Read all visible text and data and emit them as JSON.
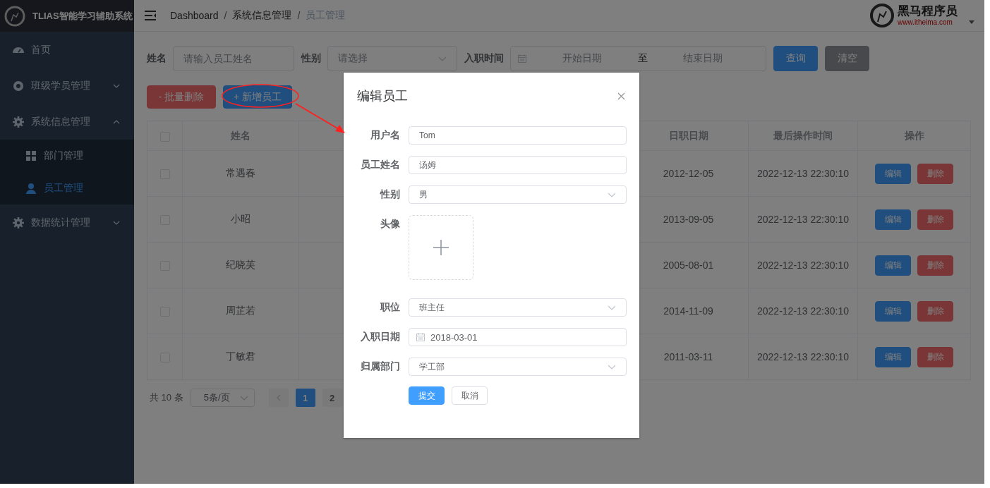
{
  "app": {
    "title": "TLIAS智能学习辅助系统"
  },
  "sidebar": {
    "items": [
      {
        "label": "首页",
        "kind": "link",
        "selected": false
      },
      {
        "label": "班级学员管理",
        "kind": "group",
        "expanded": false,
        "selected": false
      },
      {
        "label": "系统信息管理",
        "kind": "group",
        "expanded": true,
        "selected": false,
        "children": [
          {
            "label": "部门管理",
            "selected": false
          },
          {
            "label": "员工管理",
            "selected": true
          }
        ]
      },
      {
        "label": "数据统计管理",
        "kind": "group",
        "expanded": false,
        "selected": false
      }
    ]
  },
  "header": {
    "breadcrumb": [
      "Dashboard",
      "系统信息管理",
      "员工管理"
    ],
    "breadcrumb_separator": "/",
    "brand": {
      "name": "黑马程序员",
      "url": "www.itheima.com"
    }
  },
  "search": {
    "name_label": "姓名",
    "name_placeholder": "请输入员工姓名",
    "gender_label": "性别",
    "gender_placeholder": "请选择",
    "date_label": "入职时间",
    "start_placeholder": "开始日期",
    "range_separator": "至",
    "end_placeholder": "结束日期",
    "query_button": "查询",
    "clear_button": "清空"
  },
  "actions": [
    {
      "label": "- 批量删除",
      "kind": "danger"
    },
    {
      "label": "+ 新增员工",
      "kind": "primary"
    }
  ],
  "table": {
    "columns": [
      "姓名",
      "日职日期",
      "最后操作时间",
      "操作"
    ],
    "header_checked": false,
    "rows": [
      {
        "checked": false,
        "name": "常遇春",
        "entry_date": "2012-12-05",
        "update_time": "2022-12-13 22:30:10",
        "actions": [
          "编辑",
          "删除"
        ]
      },
      {
        "checked": false,
        "name": "小昭",
        "entry_date": "2013-09-05",
        "update_time": "2022-12-13 22:30:10",
        "actions": [
          "编辑",
          "删除"
        ]
      },
      {
        "checked": false,
        "name": "纪晓芙",
        "entry_date": "2005-08-01",
        "update_time": "2022-12-13 22:30:10",
        "actions": [
          "编辑",
          "删除"
        ]
      },
      {
        "checked": false,
        "name": "周芷若",
        "entry_date": "2014-11-09",
        "update_time": "2022-12-13 22:30:10",
        "actions": [
          "编辑",
          "删除"
        ]
      },
      {
        "checked": false,
        "name": "丁敏君",
        "entry_date": "2011-03-11",
        "update_time": "2022-12-13 22:30:10",
        "actions": [
          "编辑",
          "删除"
        ]
      }
    ]
  },
  "pagination": {
    "total": "共 10 条",
    "page_size": "5条/页",
    "pages": [
      {
        "label": "1",
        "selected": true
      },
      {
        "label": "2",
        "selected": false
      }
    ]
  },
  "dialog": {
    "title": "编辑员工",
    "fields": [
      {
        "kind": "text",
        "label": "用户名",
        "value": "Tom"
      },
      {
        "kind": "text",
        "label": "员工姓名",
        "value": "汤姆"
      },
      {
        "kind": "select",
        "label": "性别",
        "value": "男"
      },
      {
        "kind": "upload",
        "label": "头像"
      },
      {
        "kind": "select",
        "label": "职位",
        "value": "班主任"
      },
      {
        "kind": "date",
        "label": "入职日期",
        "value": "2018-03-01"
      },
      {
        "kind": "select",
        "label": "归属部门",
        "value": "学工部"
      }
    ],
    "submit": "提交",
    "cancel": "取消"
  }
}
